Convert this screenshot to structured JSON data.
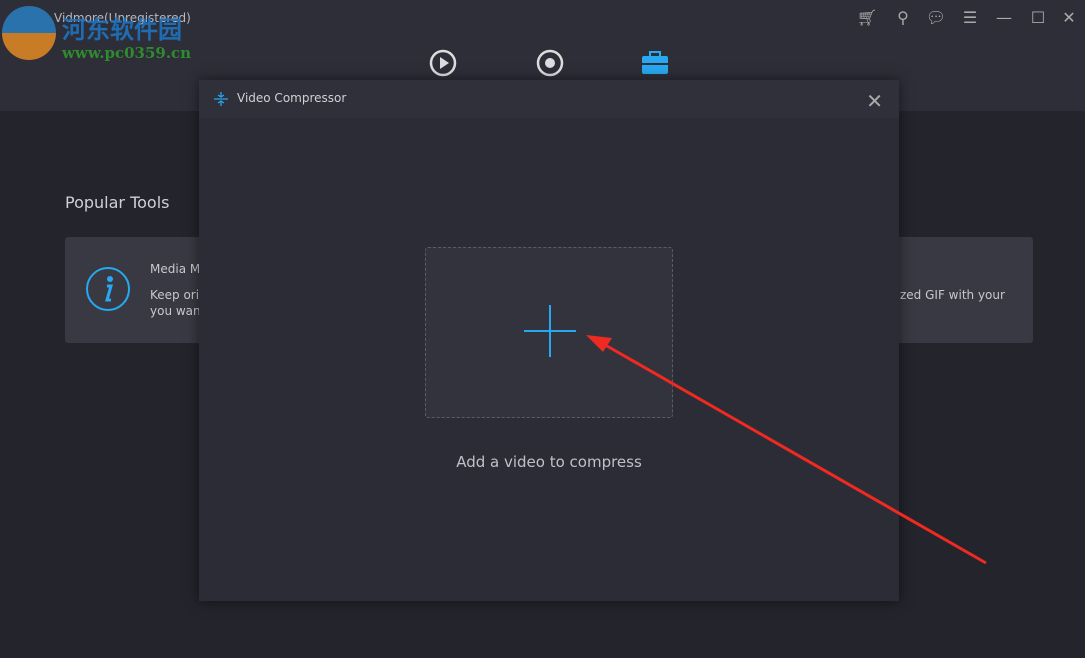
{
  "app": {
    "title": "Vidmore(Unregistered)"
  },
  "watermark": {
    "text": "河东软件园",
    "url": "www.pc0359.cn"
  },
  "window_controls": [
    "cart-icon",
    "key-icon",
    "feedback-icon",
    "menu-icon",
    "minimize-icon",
    "maximize-icon",
    "close-icon"
  ],
  "nav": [
    "converter-icon",
    "recorder-icon",
    "toolbox-icon"
  ],
  "main": {
    "section_title": "Popular Tools",
    "cards": [
      {
        "title": "Media M",
        "desc1": "Keep orig",
        "desc2": "you want"
      },
      {
        "desc1": "zed GIF with your"
      }
    ]
  },
  "dialog": {
    "title": "Video Compressor",
    "add_label": "Add a video to compress"
  },
  "colors": {
    "accent": "#27a8f0"
  }
}
